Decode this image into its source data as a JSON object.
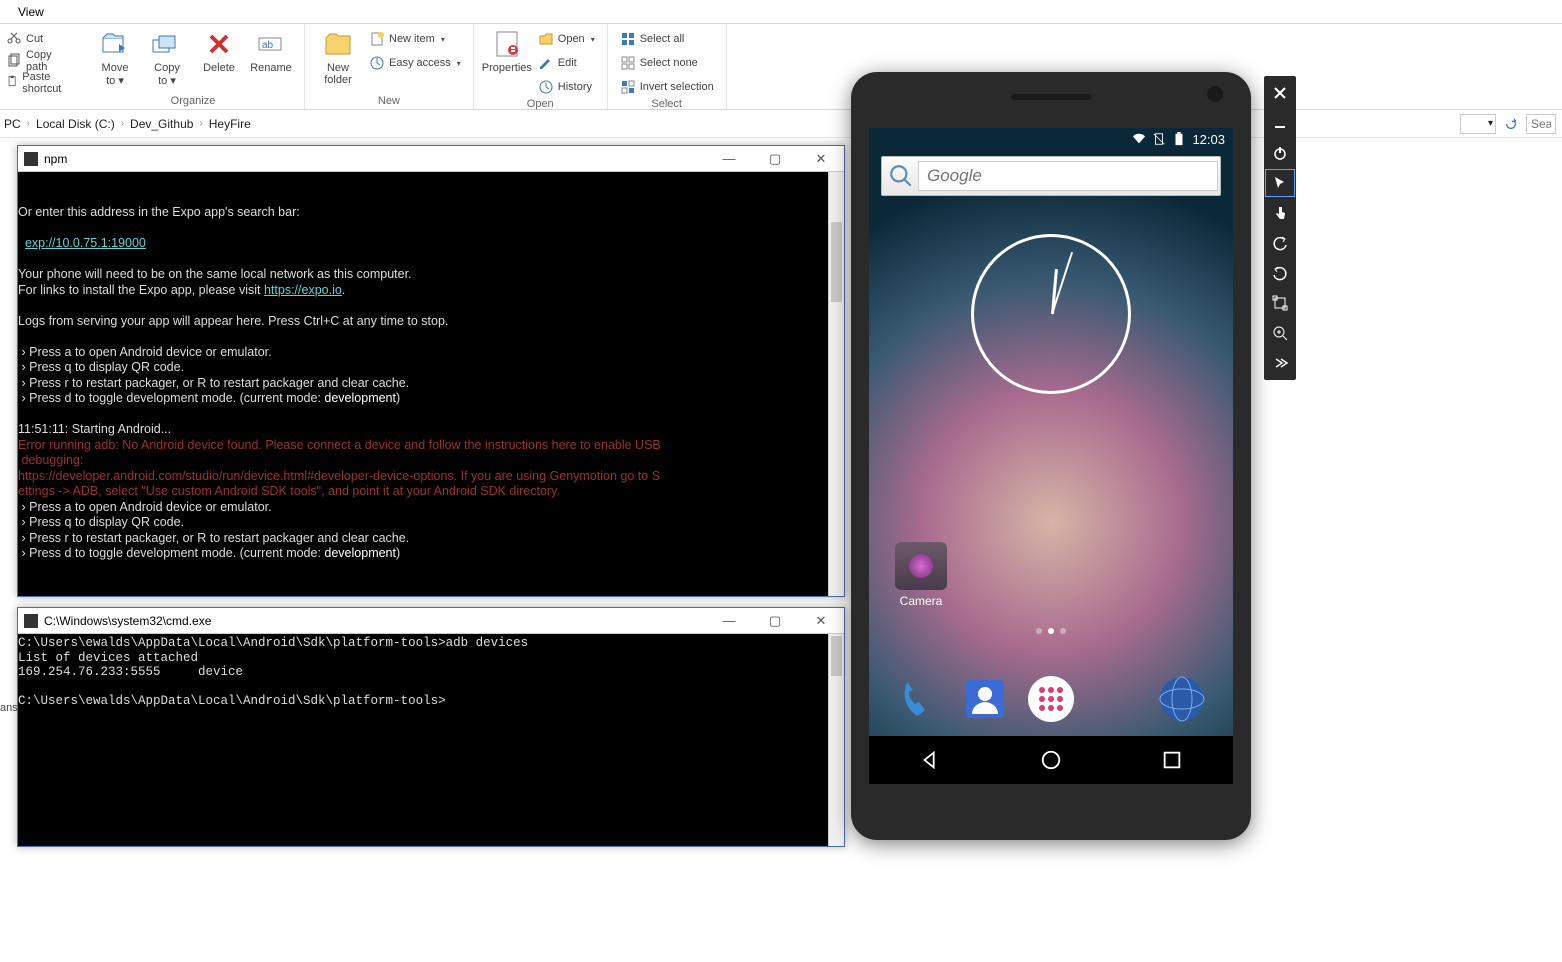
{
  "ribbon": {
    "tab": "View",
    "clipboard": {
      "cut": "Cut",
      "copy_path": "Copy path",
      "paste_shortcut": "Paste shortcut"
    },
    "organize": {
      "label": "Organize",
      "move_to": "Move\nto ▾",
      "copy_to": "Copy\nto ▾",
      "delete": "Delete",
      "rename": "Rename"
    },
    "new": {
      "label": "New",
      "new_folder": "New\nfolder",
      "new_item": "New item",
      "easy_access": "Easy access"
    },
    "open": {
      "label": "Open",
      "properties": "Properties",
      "open": "Open",
      "edit": "Edit",
      "history": "History"
    },
    "select": {
      "label": "Select",
      "select_all": "Select all",
      "select_none": "Select none",
      "invert": "Invert selection"
    }
  },
  "breadcrumb": {
    "pc": "PC",
    "c": "Local Disk (C:)",
    "dev": "Dev_Github",
    "proj": "HeyFire",
    "search": "Sea"
  },
  "term1": {
    "title": "npm",
    "lines_a": "\n\nOr enter this address in the Expo app's search bar:\n\n  ",
    "link1": "exp://10.0.75.1:19000",
    "lines_b": "\n\nYour phone will need to be on the same local network as this computer.\nFor links to install the Expo app, please visit ",
    "link2": "https://expo.io",
    "lines_c": ".\n\nLogs from serving your app will appear here. Press Ctrl+C at any time to stop.\n\n › Press a to open Android device or emulator.\n › Press q to display QR code.\n › Press r to restart packager, or R to restart packager and clear cache.\n › Press d to toggle development mode. (current mode: ",
    "mode1": "development",
    "lines_d": ")\n\n11:51:11: Starting Android...\n",
    "err": "Error running adb: No Android device found. Please connect a device and follow the instructions here to enable USB\n debugging:\nhttps://developer.android.com/studio/run/device.html#developer-device-options. If you are using Genymotion go to S\nettings -> ADB, select \"Use custom Android SDK tools\", and point it at your Android SDK directory.",
    "lines_e": "\n › Press a to open Android device or emulator.\n › Press q to display QR code.\n › Press r to restart packager, or R to restart packager and clear cache.\n › Press d to toggle development mode. (current mode: ",
    "mode2": "development",
    "lines_f": ")\n\n"
  },
  "term2": {
    "title": "C:\\Windows\\system32\\cmd.exe",
    "body": "C:\\Users\\ewalds\\AppData\\Local\\Android\\Sdk\\platform-tools>adb devices\nList of devices attached\n169.254.76.233:5555     device\n\nC:\\Users\\ewalds\\AppData\\Local\\Android\\Sdk\\platform-tools>"
  },
  "left_strip": "ans",
  "emu": {
    "time": "12:03",
    "search_placeholder": "Google",
    "camera_label": "Camera"
  }
}
